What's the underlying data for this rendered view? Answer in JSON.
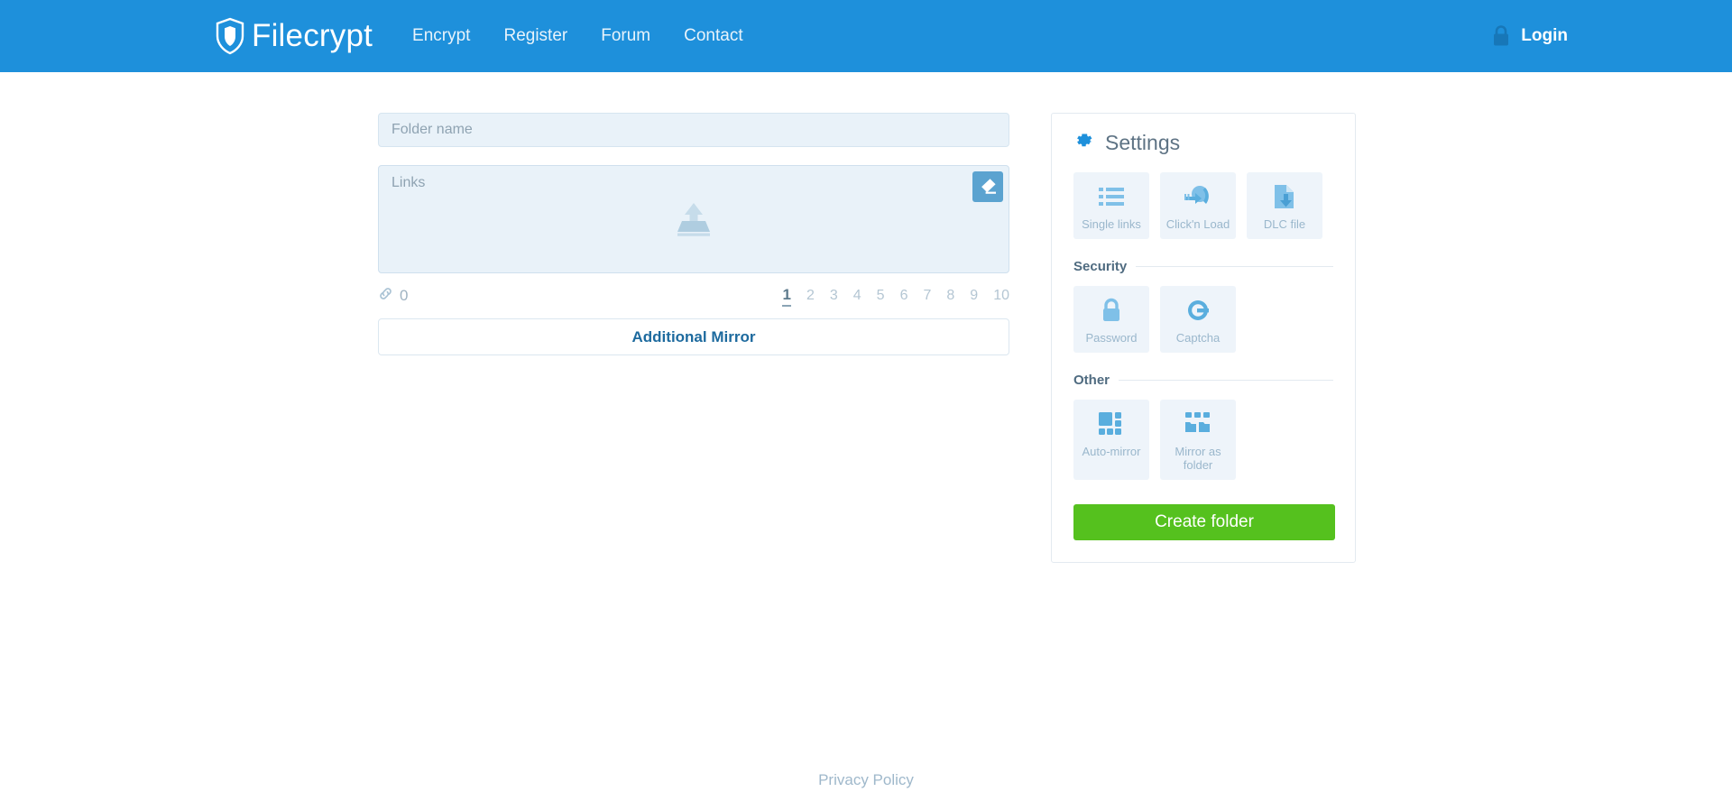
{
  "header": {
    "brand": "Filecrypt",
    "brand_icon": "shield-icon",
    "nav": [
      {
        "label": "Encrypt"
      },
      {
        "label": "Register"
      },
      {
        "label": "Forum"
      },
      {
        "label": "Contact"
      }
    ],
    "login": {
      "label": "Login",
      "icon": "lock-icon"
    },
    "background_color": "#1e90db"
  },
  "form": {
    "folder_name": {
      "placeholder": "Folder name",
      "value": ""
    },
    "links": {
      "placeholder": "Links",
      "value": "",
      "icon": "upload-icon"
    },
    "clear_button": {
      "icon": "eraser-icon"
    },
    "link_counter": {
      "icon": "chain-link-icon",
      "count": "0"
    },
    "pagination": {
      "pages": [
        "1",
        "2",
        "3",
        "4",
        "5",
        "6",
        "7",
        "8",
        "9",
        "10"
      ],
      "active": "1"
    },
    "additional_mirror": {
      "label": "Additional Mirror"
    }
  },
  "settings": {
    "title": "Settings",
    "title_icon": "gear-icon",
    "link_types": [
      {
        "label": "Single links",
        "icon": "list-icon"
      },
      {
        "label": "Click'n Load",
        "icon": "clicknload-icon"
      },
      {
        "label": "DLC file",
        "icon": "dlc-file-icon"
      }
    ],
    "security": {
      "title": "Security",
      "options": [
        {
          "label": "Password",
          "icon": "padlock-icon"
        },
        {
          "label": "Captcha",
          "icon": "captcha-icon"
        }
      ]
    },
    "other": {
      "title": "Other",
      "options": [
        {
          "label": "Auto-mirror",
          "icon": "grid-icon"
        },
        {
          "label": "Mirror as folder",
          "icon": "folders-icon"
        }
      ]
    },
    "create_button": {
      "label": "Create folder",
      "color": "#55c11e"
    }
  },
  "footer": {
    "privacy_policy": "Privacy Policy"
  }
}
